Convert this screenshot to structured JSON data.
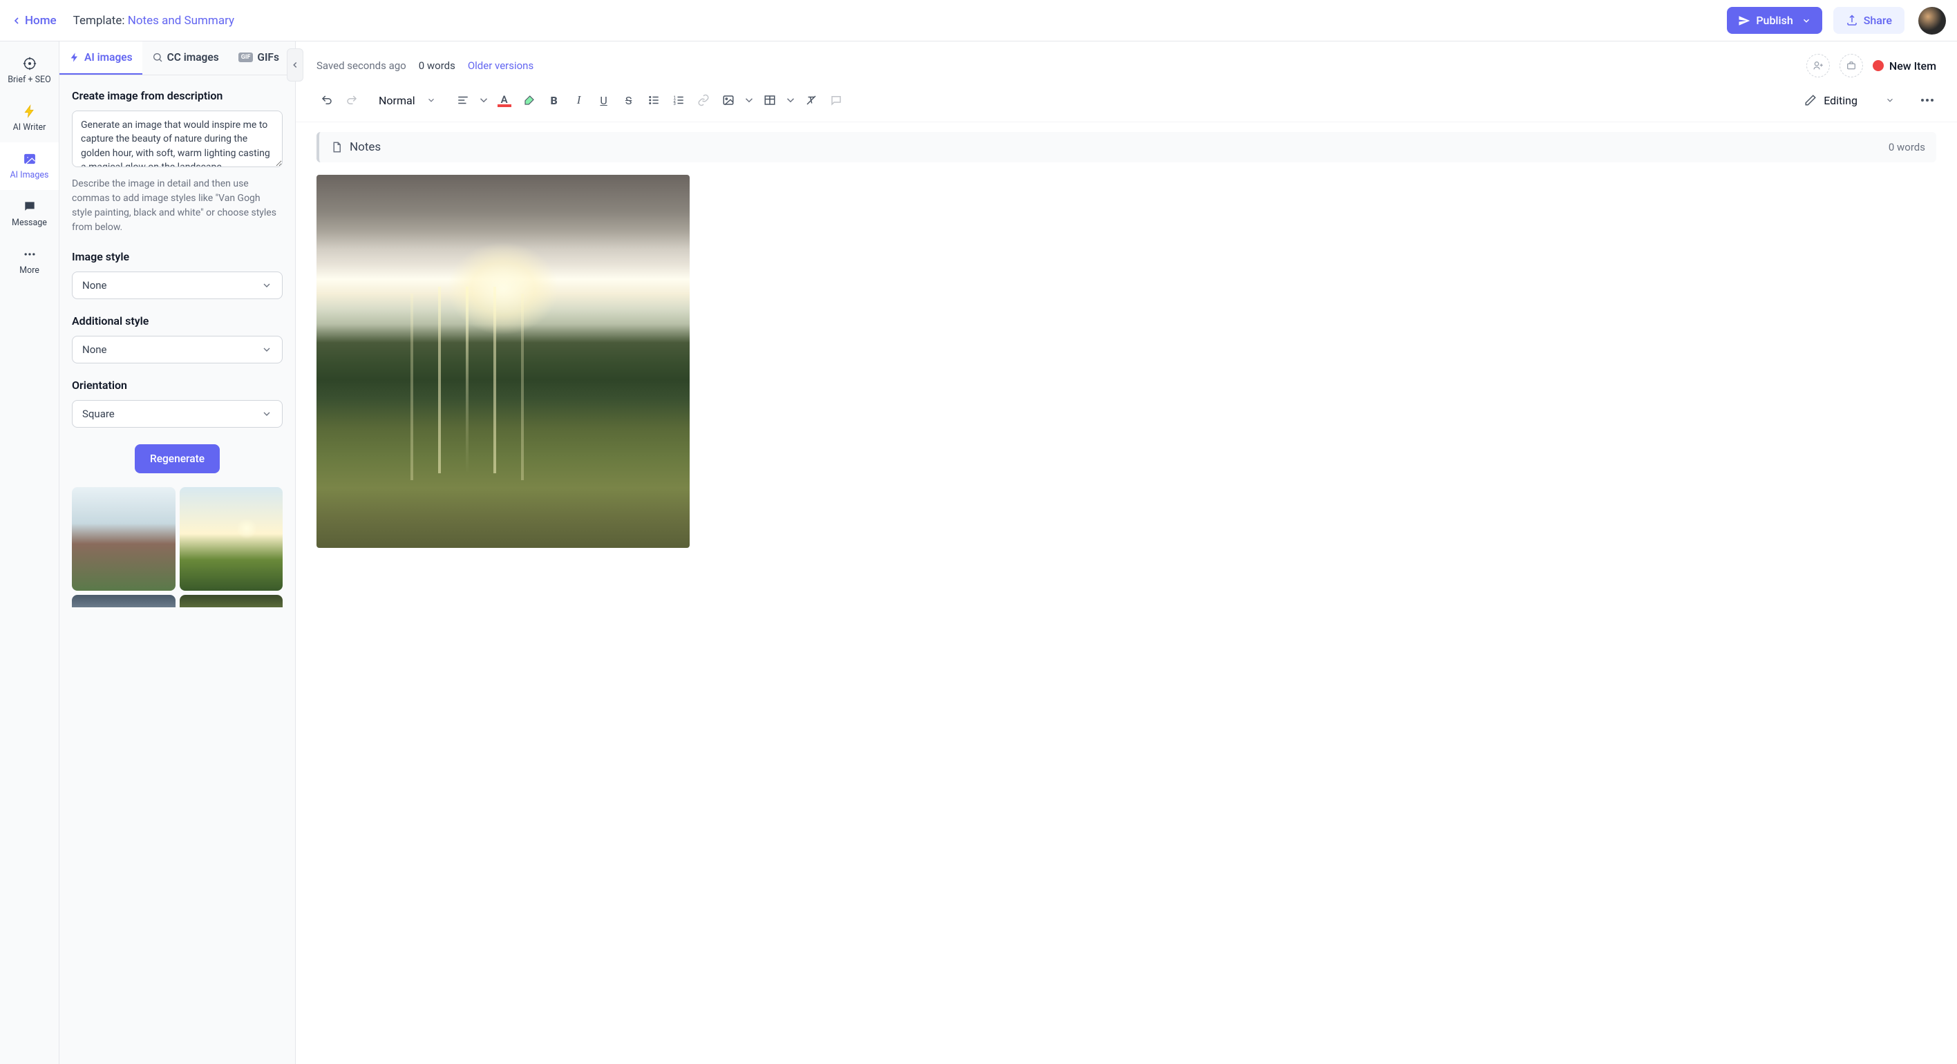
{
  "header": {
    "home": "Home",
    "template_prefix": "Template: ",
    "template_name": "Notes and Summary",
    "publish": "Publish",
    "share": "Share"
  },
  "rail": {
    "brief": "Brief + SEO",
    "writer": "AI Writer",
    "images": "AI Images",
    "message": "Message",
    "more": "More"
  },
  "tabs": {
    "ai_images": "AI images",
    "cc_images": "CC images",
    "gifs": "GIFs"
  },
  "panel": {
    "create_label": "Create image from description",
    "prompt": "Generate an image that would inspire me to capture the beauty of nature during the golden hour, with soft, warm lighting casting a magical glow on the landscape",
    "helper": "Describe the image in detail and then use commas to add image styles like \"Van Gogh style painting, black and white\" or choose styles from below.",
    "image_style_label": "Image style",
    "image_style_value": "None",
    "additional_style_label": "Additional style",
    "additional_style_value": "None",
    "orientation_label": "Orientation",
    "orientation_value": "Square",
    "regenerate": "Regenerate"
  },
  "editor": {
    "saved": "Saved seconds ago",
    "words_top": "0 words",
    "older_versions": "Older versions",
    "new_item": "New Item",
    "paragraph_style": "Normal",
    "editing_mode": "Editing",
    "notes_title": "Notes",
    "notes_words": "0 words"
  }
}
